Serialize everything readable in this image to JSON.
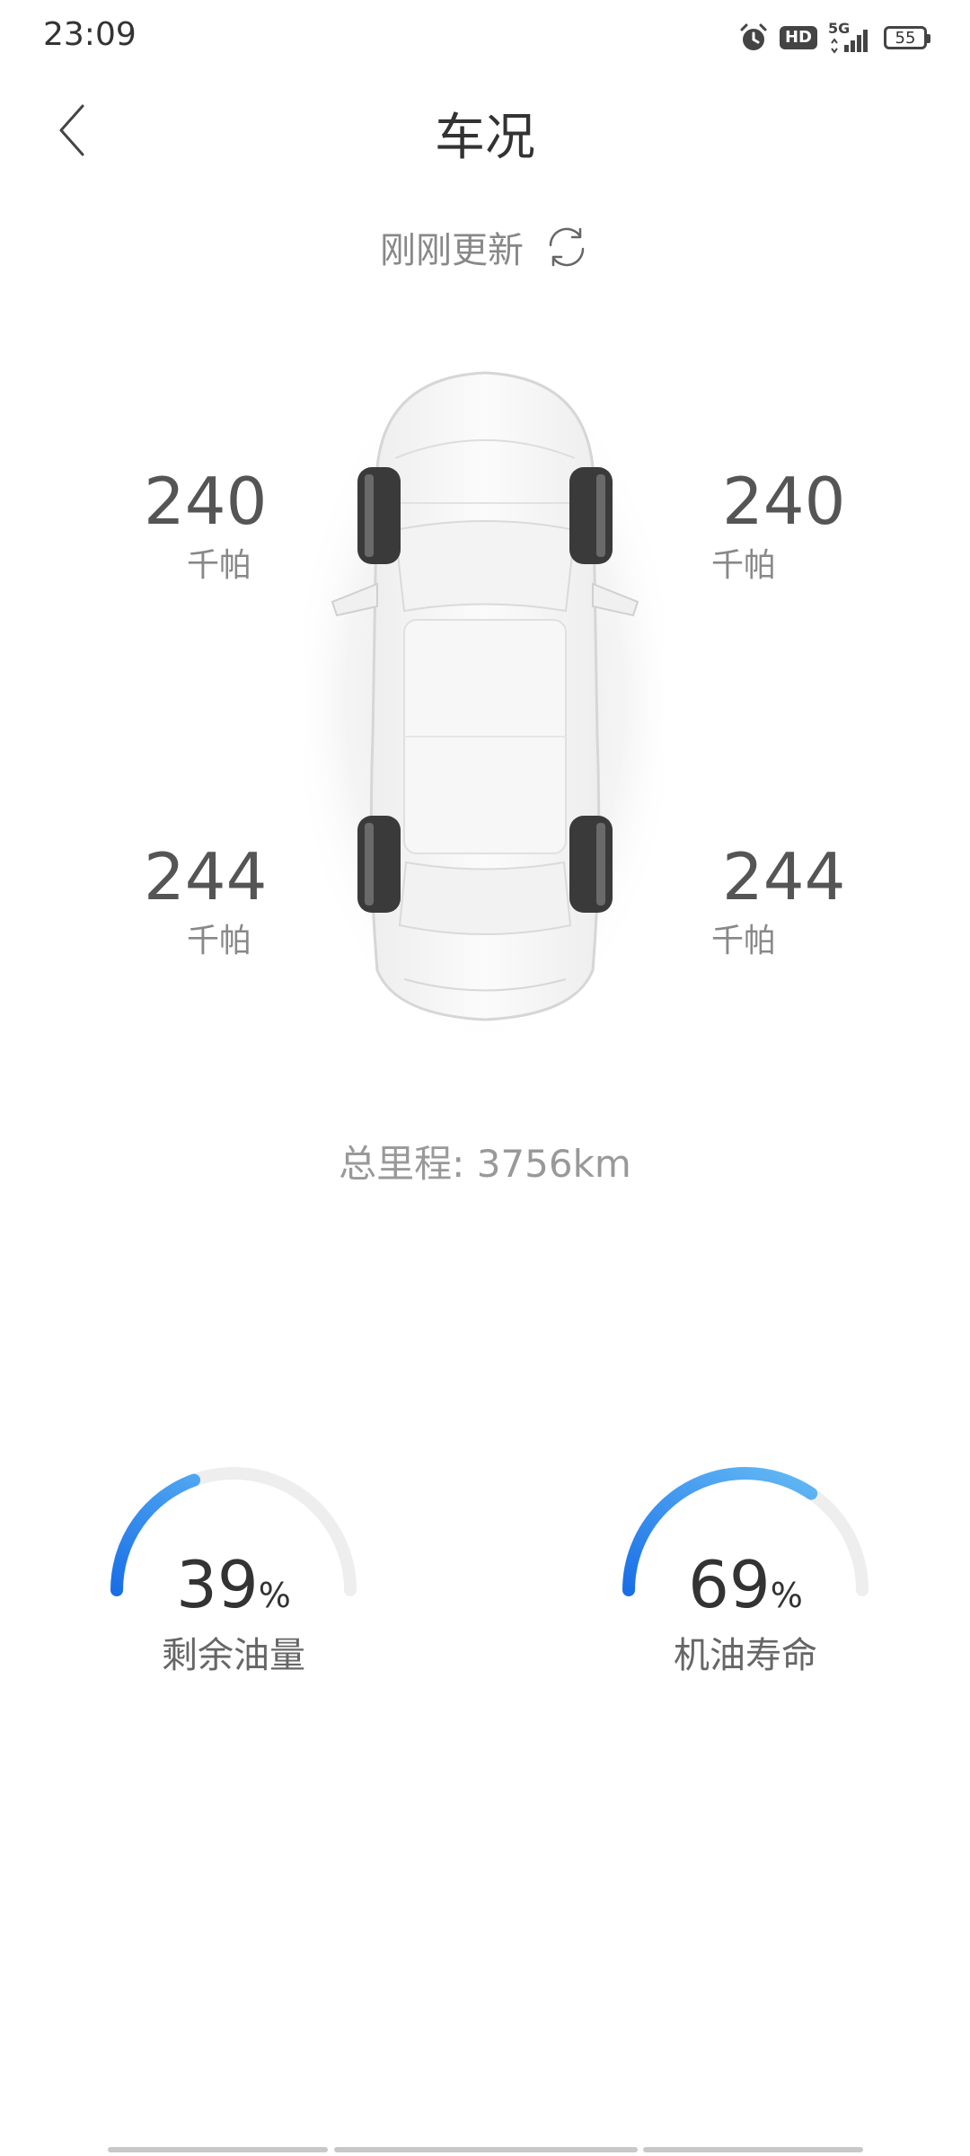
{
  "status_bar": {
    "time": "23:09",
    "icons": [
      "alarm-icon",
      "hd-icon",
      "5g-signal-icon",
      "battery-icon"
    ],
    "hd_label": "HD",
    "network_label": "5G",
    "battery_level": "55"
  },
  "header": {
    "title": "车况",
    "back_icon": "chevron-left-icon"
  },
  "update": {
    "text": "刚刚更新",
    "refresh_icon": "refresh-icon"
  },
  "tires": {
    "front_left": {
      "value": "240",
      "unit": "千帕"
    },
    "front_right": {
      "value": "240",
      "unit": "千帕"
    },
    "rear_left": {
      "value": "244",
      "unit": "千帕"
    },
    "rear_right": {
      "value": "244",
      "unit": "千帕"
    }
  },
  "mileage": {
    "label": "总里程: ",
    "value": "3756km"
  },
  "gauges": {
    "fuel": {
      "value": "39",
      "unit": "%",
      "label": "剩余油量",
      "percent": 39
    },
    "oil": {
      "value": "69",
      "unit": "%",
      "label": "机油寿命",
      "percent": 69
    }
  },
  "colors": {
    "gauge_start": "#1a6fe8",
    "gauge_end": "#6cc3f5",
    "gauge_track": "#eeeeee",
    "tire": "#3a3a3a"
  }
}
